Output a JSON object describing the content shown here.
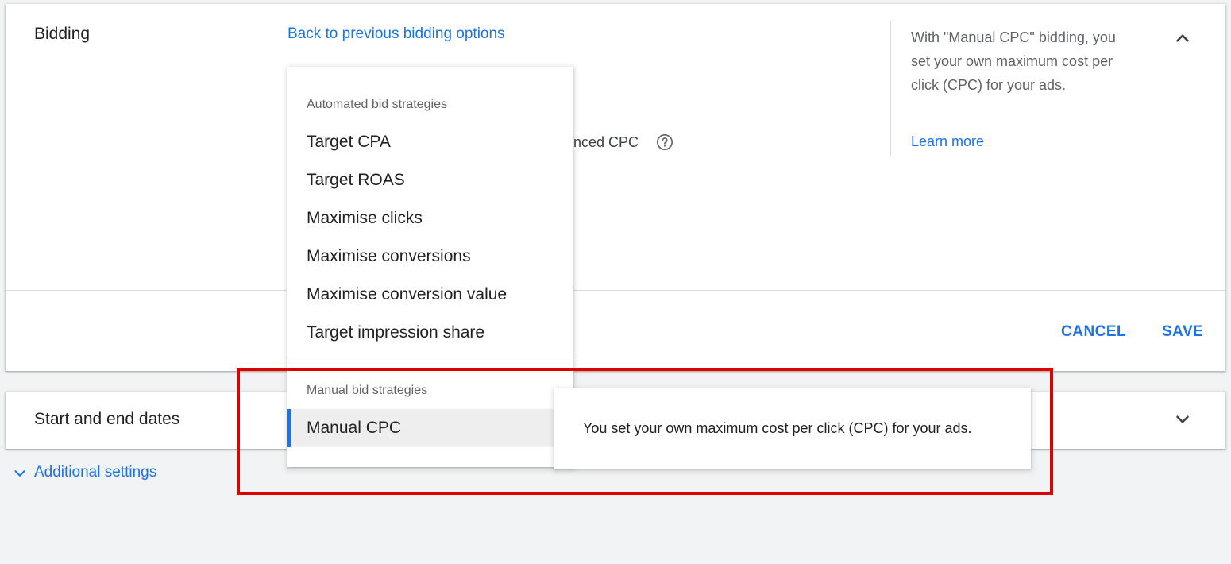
{
  "bidding": {
    "title": "Bidding",
    "back_link": "Back to previous bidding options",
    "partial_option_text": "anced CPC",
    "side_panel": {
      "description": "With \"Manual CPC\" bidding, you set your own maximum cost per click (CPC) for your ads.",
      "learn_more": "Learn more"
    },
    "cancel_label": "CANCEL",
    "save_label": "SAVE"
  },
  "dates": {
    "title": "Start and end dates"
  },
  "additional_settings": "Additional settings",
  "dropdown": {
    "automated_label": "Automated bid strategies",
    "automated_options": [
      "Target CPA",
      "Target ROAS",
      "Maximise clicks",
      "Maximise conversions",
      "Maximise conversion value",
      "Target impression share"
    ],
    "manual_label": "Manual bid strategies",
    "manual_options": [
      "Manual CPC"
    ],
    "selected": "Manual CPC"
  },
  "tooltip": {
    "text": "You set your own maximum cost per click (CPC) for your ads."
  },
  "colors": {
    "link_blue": "#1a73e8",
    "highlight_red": "#e00000",
    "background": "#f1f3f4"
  },
  "icons": {
    "help": "help-circle-icon",
    "collapse": "chevron-up-icon",
    "expand": "chevron-down-icon"
  }
}
